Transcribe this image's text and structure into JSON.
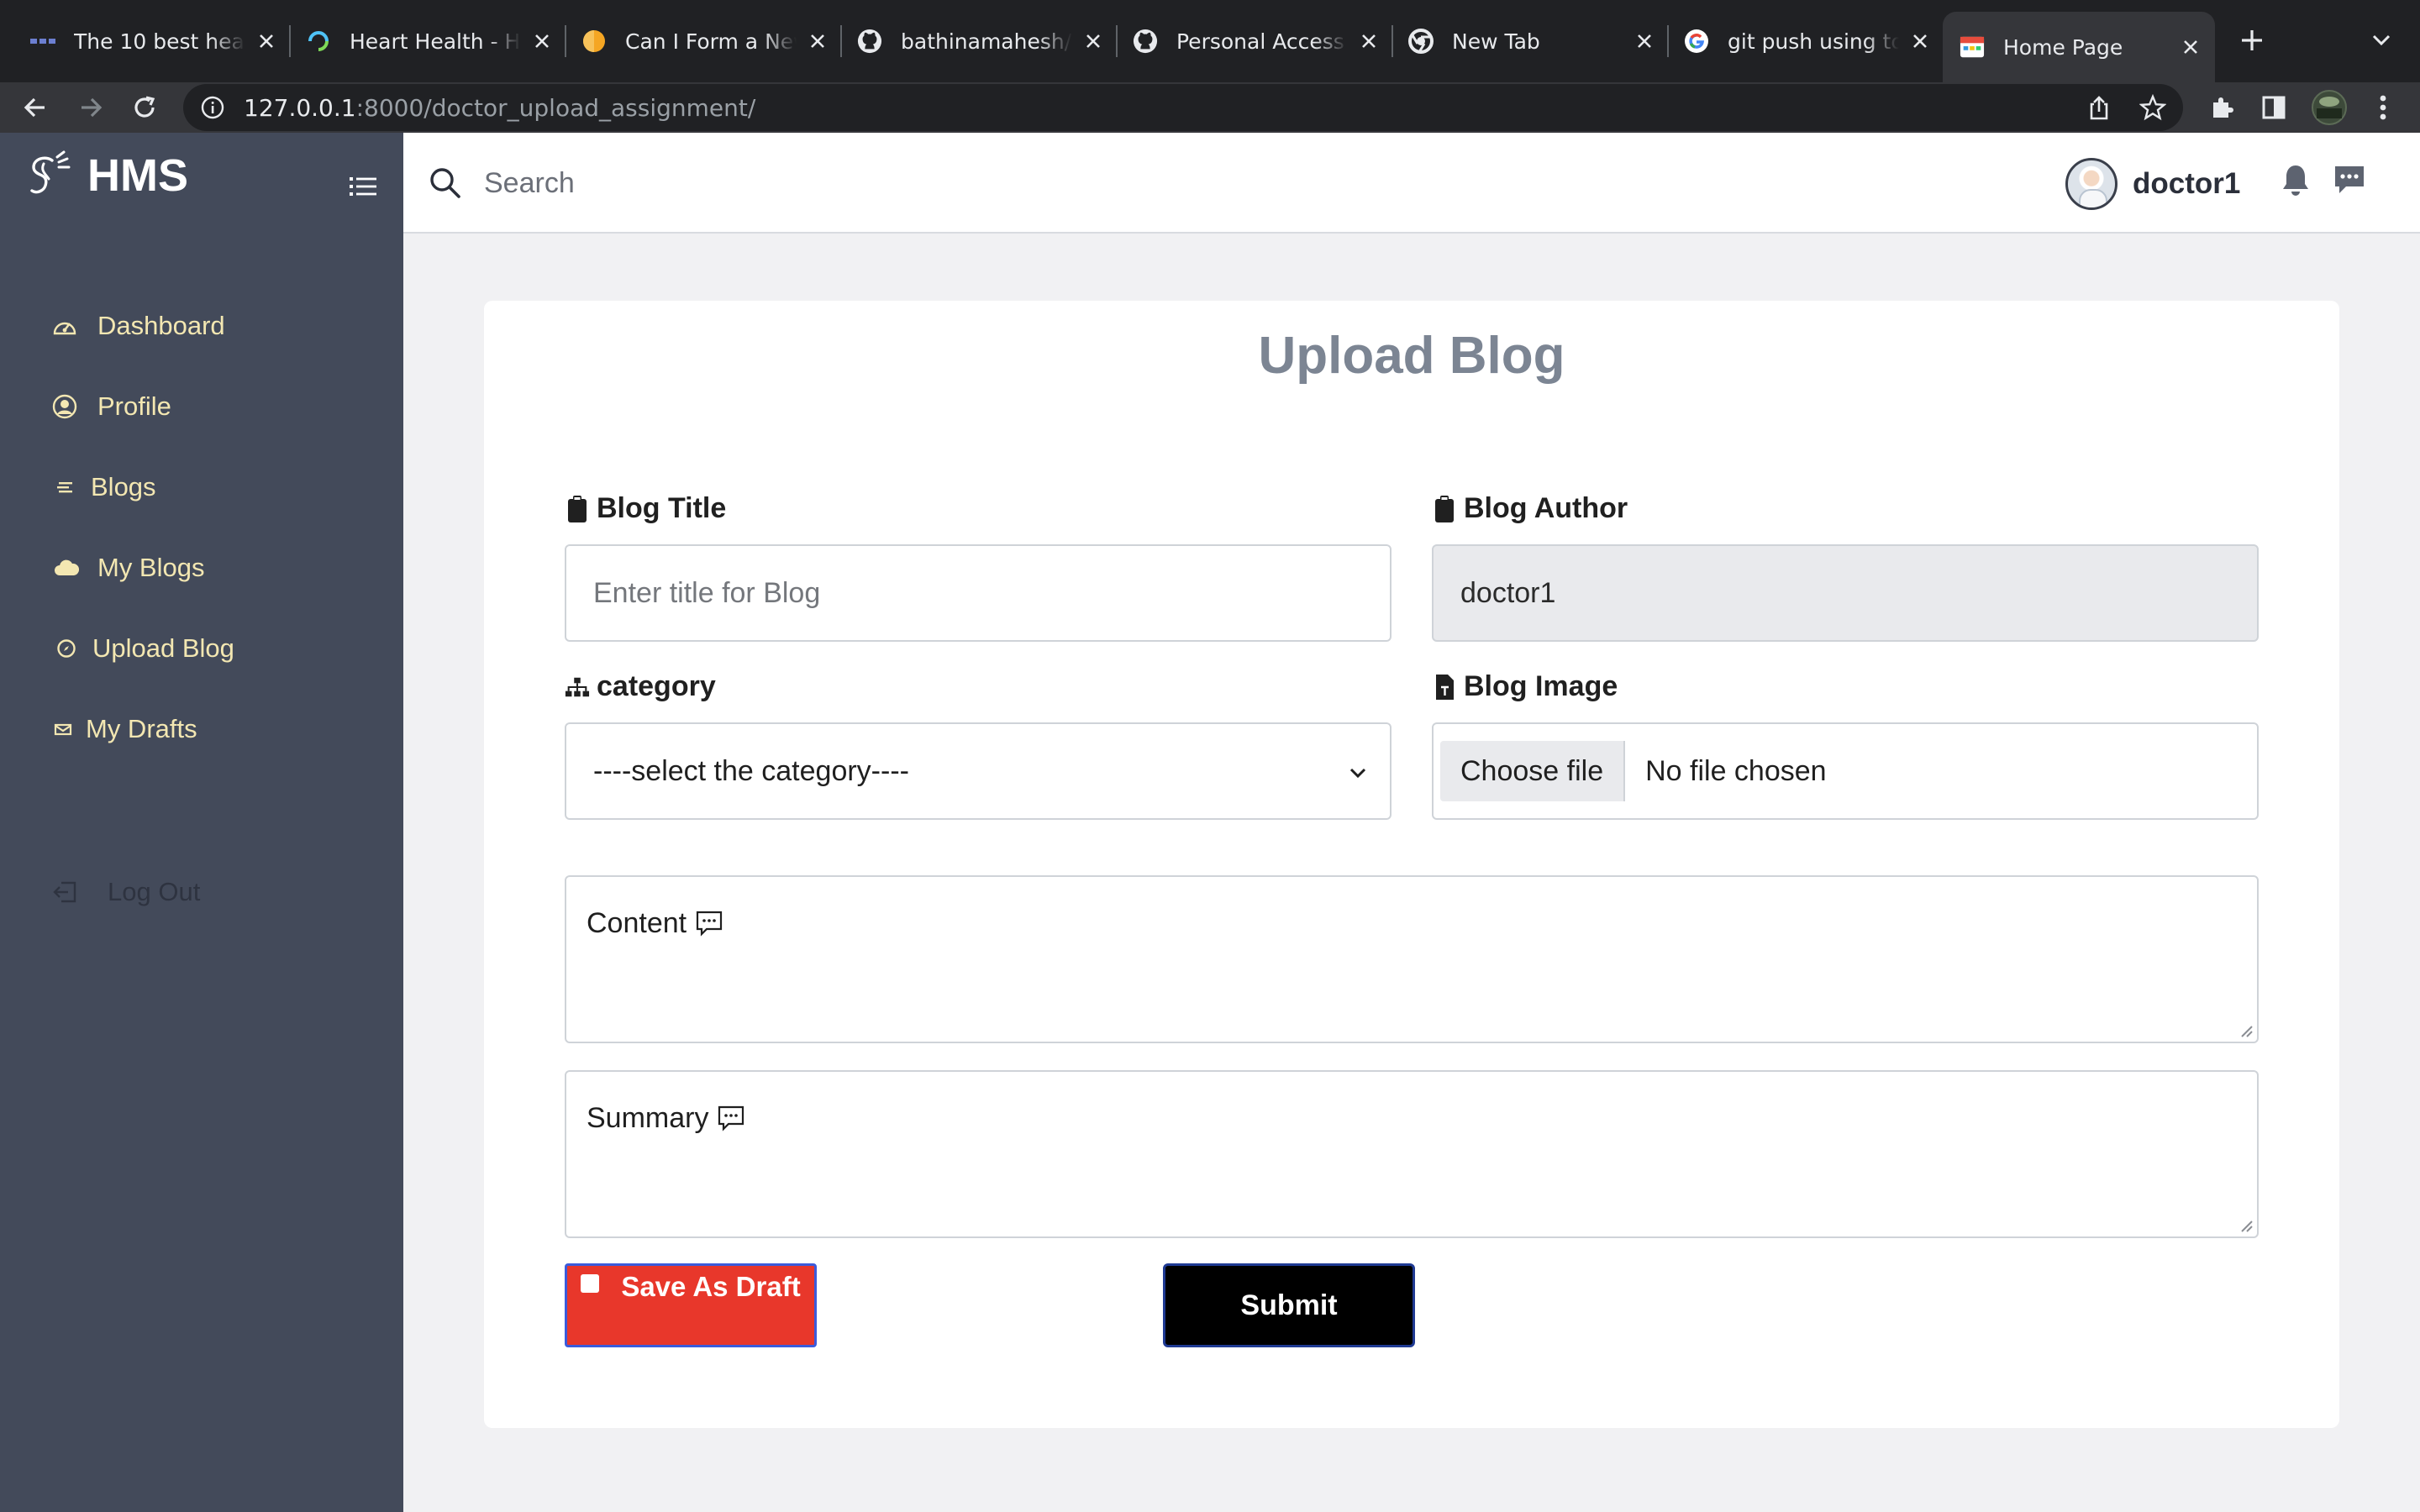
{
  "browser": {
    "tabs": [
      {
        "title": "The 10 best heart",
        "icon": "waveform-favicon-icon",
        "active": false
      },
      {
        "title": "Heart Health - Ho",
        "icon": "circle-favicon-icon",
        "active": false
      },
      {
        "title": "Can I Form a New",
        "icon": "orange-circle-favicon-icon",
        "active": false
      },
      {
        "title": "bathinamahesh/Fi",
        "icon": "github-icon",
        "active": false
      },
      {
        "title": "Personal Access T",
        "icon": "github-icon",
        "active": false
      },
      {
        "title": "New Tab",
        "icon": "chrome-icon",
        "active": false
      },
      {
        "title": "git push using tok",
        "icon": "google-icon",
        "active": false
      },
      {
        "title": "Home Page",
        "icon": "calendar-favicon-icon",
        "active": true
      }
    ],
    "url_host": "127.0.0.1",
    "url_path": ":8000/doctor_upload_assignment/"
  },
  "sidebar": {
    "brand": "HMS",
    "items": [
      {
        "label": "Dashboard",
        "icon": "dashboard-gauge-icon"
      },
      {
        "label": "Profile",
        "icon": "user-circle-icon"
      },
      {
        "label": "Blogs",
        "icon": "lines-icon"
      },
      {
        "label": "My Blogs",
        "icon": "cloud-icon"
      },
      {
        "label": "Upload Blog",
        "icon": "compass-icon"
      },
      {
        "label": "My Drafts",
        "icon": "envelope-icon"
      }
    ],
    "logout": "Log Out"
  },
  "header": {
    "search_placeholder": "Search",
    "username": "doctor1"
  },
  "form": {
    "title": "Upload Blog",
    "blog_title_label": "Blog Title",
    "blog_title_placeholder": "Enter title for Blog",
    "blog_author_label": "Blog Author",
    "blog_author_value": "doctor1",
    "category_label": "category",
    "category_selected": "----select the category----",
    "blog_image_label": "Blog Image",
    "choose_file_label": "Choose file",
    "file_status": "No file chosen",
    "content_label": "Content",
    "summary_label": "Summary",
    "save_draft_label": "Save As Draft",
    "submit_label": "Submit"
  },
  "colors": {
    "sidebar_bg": "#434a5a",
    "sidebar_text": "#f3e7b2",
    "draft_button": "#e8372b",
    "submit_button": "#000000",
    "title_color": "#7c8593"
  }
}
